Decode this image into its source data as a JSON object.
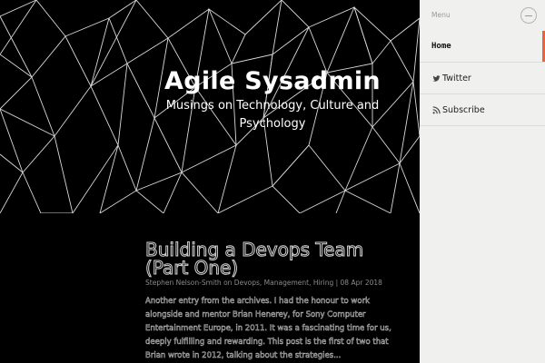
{
  "site": {
    "title": "Agile Sysadmin",
    "tagline": "Musings on Technology, Culture and Psychology"
  },
  "post": {
    "title": "Building a Devops Team (Part One)",
    "meta": "Stephen Nelson-Smith on Devops, Management, Hiring | 08 Apr 2018",
    "excerpt": "Another entry from the archives. I had the honour to work alongside and mentor Brian Henerey, for Sony Computer Entertainment Europe, in 2011. It was a fascinating time for us, deeply fulfilling and rewarding. This post is the first of two that Brian wrote in 2012, talking about the strategies..."
  },
  "sidebar": {
    "menu_label": "Menu",
    "items": [
      {
        "label": "Home",
        "icon": "none",
        "active": true
      },
      {
        "label": "Twitter",
        "icon": "twitter-bird-icon"
      },
      {
        "label": "Subscribe",
        "icon": "rss-icon"
      }
    ]
  },
  "colors": {
    "accent": "#e8643a",
    "sidebar_bg": "#f0f0ee",
    "hero_bg": "#000000",
    "line": "#d8d8d8"
  }
}
